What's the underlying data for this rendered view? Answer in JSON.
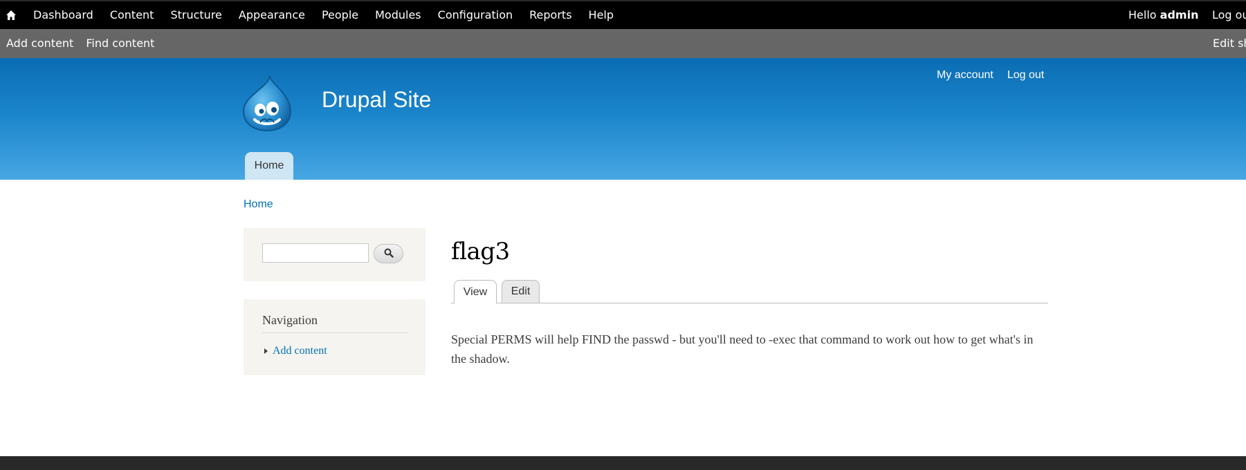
{
  "toolbar": {
    "menu": [
      "Dashboard",
      "Content",
      "Structure",
      "Appearance",
      "People",
      "Modules",
      "Configuration",
      "Reports",
      "Help"
    ],
    "hello": "Hello",
    "username": "admin",
    "logout": "Log out",
    "home_icon": "home-icon"
  },
  "shortcuts": {
    "items": [
      "Add content",
      "Find content"
    ],
    "edit": "Edit shortcuts"
  },
  "header": {
    "site_name": "Drupal Site",
    "secondary_menu": [
      "My account",
      "Log out"
    ],
    "main_menu": [
      "Home"
    ],
    "logo_icon": "drupal-drop-logo"
  },
  "breadcrumb": [
    "Home"
  ],
  "sidebar": {
    "search": {
      "value": "",
      "button_icon": "search-icon"
    },
    "navigation": {
      "title": "Navigation",
      "items": [
        "Add content"
      ]
    }
  },
  "main": {
    "title": "flag3",
    "tabs": [
      {
        "label": "View",
        "active": true
      },
      {
        "label": "Edit",
        "active": false
      }
    ],
    "body": "Special PERMS will help FIND the passwd - but you'll need to -exec that command to work out how to get what's in the shadow."
  },
  "colors": {
    "toolbar_bg": "#000000",
    "shortcuts_bg": "#666666",
    "header_top": "#0b6db3",
    "header_bottom": "#47a7e3",
    "link": "#0071b3",
    "sidebar_bg": "#f5f4f0",
    "footer_bg": "#292929"
  }
}
